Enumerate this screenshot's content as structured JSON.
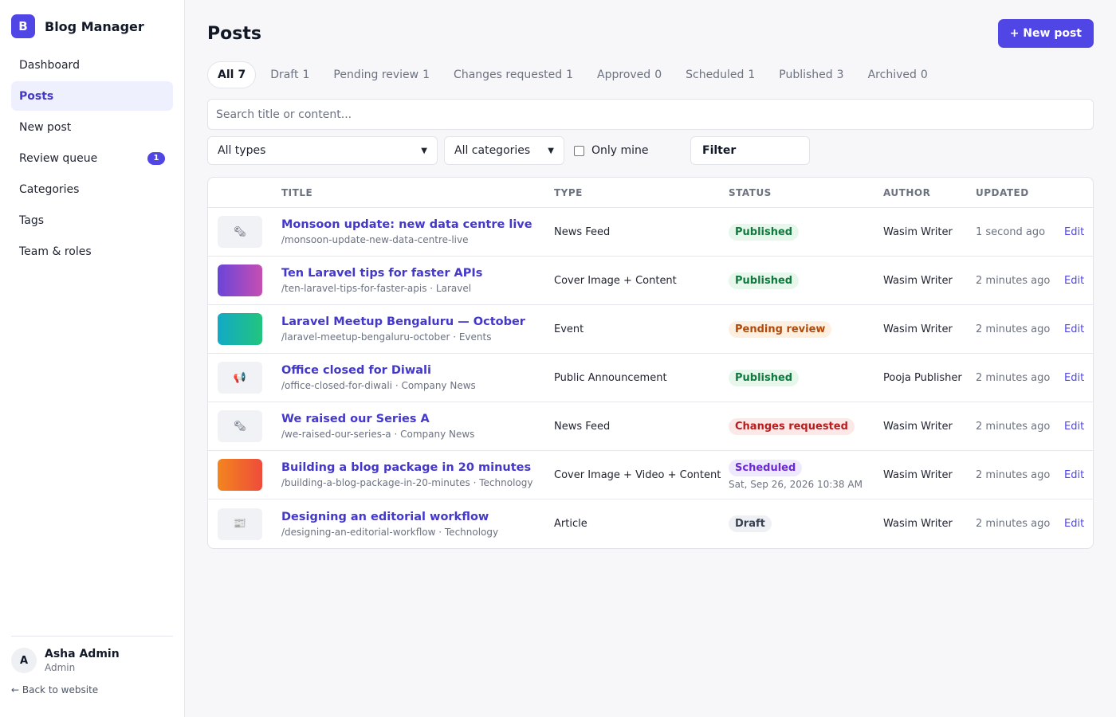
{
  "brand": {
    "logo_letter": "B",
    "name": "Blog Manager",
    "accent": "#4f46e5"
  },
  "sidebar": {
    "items": [
      {
        "label": "Dashboard",
        "active": false
      },
      {
        "label": "Posts",
        "active": true
      },
      {
        "label": "New post",
        "active": false
      },
      {
        "label": "Review queue",
        "active": false,
        "badge": "1"
      },
      {
        "label": "Categories",
        "active": false
      },
      {
        "label": "Tags",
        "active": false
      },
      {
        "label": "Team & roles",
        "active": false
      }
    ],
    "user": {
      "initial": "A",
      "name": "Asha Admin",
      "role": "Admin"
    },
    "back_link": "← Back to website"
  },
  "header": {
    "title": "Posts",
    "new_post_label": "+ New post"
  },
  "tabs": [
    {
      "label": "All",
      "count": "7",
      "active": true
    },
    {
      "label": "Draft",
      "count": "1"
    },
    {
      "label": "Pending review",
      "count": "1"
    },
    {
      "label": "Changes requested",
      "count": "1"
    },
    {
      "label": "Approved",
      "count": "0"
    },
    {
      "label": "Scheduled",
      "count": "1"
    },
    {
      "label": "Published",
      "count": "3"
    },
    {
      "label": "Archived",
      "count": "0"
    }
  ],
  "search": {
    "placeholder": "Search title or content...",
    "value": ""
  },
  "filters": {
    "type_selected": "All types",
    "category_selected": "All categories",
    "only_mine_label": "Only mine",
    "only_mine_checked": false,
    "filter_button": "Filter"
  },
  "table": {
    "columns": [
      "",
      "TITLE",
      "TYPE",
      "STATUS",
      "AUTHOR",
      "UPDATED",
      ""
    ],
    "rows": [
      {
        "thumb": "newspaper-icon",
        "thumb_glyph": "🗞",
        "title": "Monsoon update: new data centre live",
        "meta": "/monsoon-update-new-data-centre-live",
        "type": "News Feed",
        "status": "Published",
        "status_kind": "published",
        "author": "Wasim Writer",
        "updated": "1 second ago",
        "action": "Edit"
      },
      {
        "thumb": "gradient-purple",
        "title": "Ten Laravel tips for faster APIs",
        "meta": "/ten-laravel-tips-for-faster-apis · Laravel",
        "type": "Cover Image + Content",
        "status": "Published",
        "status_kind": "published",
        "author": "Wasim Writer",
        "updated": "2 minutes ago",
        "action": "Edit"
      },
      {
        "thumb": "gradient-teal",
        "title": "Laravel Meetup Bengaluru — October",
        "meta": "/laravel-meetup-bengaluru-october · Events",
        "type": "Event",
        "status": "Pending review",
        "status_kind": "pending",
        "author": "Wasim Writer",
        "updated": "2 minutes ago",
        "action": "Edit"
      },
      {
        "thumb": "megaphone-icon",
        "thumb_glyph": "📢",
        "title": "Office closed for Diwali",
        "meta": "/office-closed-for-diwali · Company News",
        "type": "Public Announcement",
        "status": "Published",
        "status_kind": "published",
        "author": "Pooja Publisher",
        "updated": "2 minutes ago",
        "action": "Edit"
      },
      {
        "thumb": "newspaper-icon",
        "thumb_glyph": "🗞",
        "title": "We raised our Series A",
        "meta": "/we-raised-our-series-a · Company News",
        "type": "News Feed",
        "status": "Changes requested",
        "status_kind": "changes",
        "author": "Wasim Writer",
        "updated": "2 minutes ago",
        "action": "Edit"
      },
      {
        "thumb": "gradient-orange",
        "title": "Building a blog package in 20 minutes",
        "meta": "/building-a-blog-package-in-20-minutes · Technology",
        "type": "Cover Image + Video + Content",
        "status": "Scheduled",
        "status_kind": "scheduled",
        "scheduled_for": "Sat, Sep 26, 2026 10:38 AM",
        "author": "Wasim Writer",
        "updated": "2 minutes ago",
        "action": "Edit"
      },
      {
        "thumb": "article-icon",
        "thumb_glyph": "📰",
        "title": "Designing an editorial workflow",
        "meta": "/designing-an-editorial-workflow · Technology",
        "type": "Article",
        "status": "Draft",
        "status_kind": "draft",
        "author": "Wasim Writer",
        "updated": "2 minutes ago",
        "action": "Edit"
      }
    ]
  }
}
